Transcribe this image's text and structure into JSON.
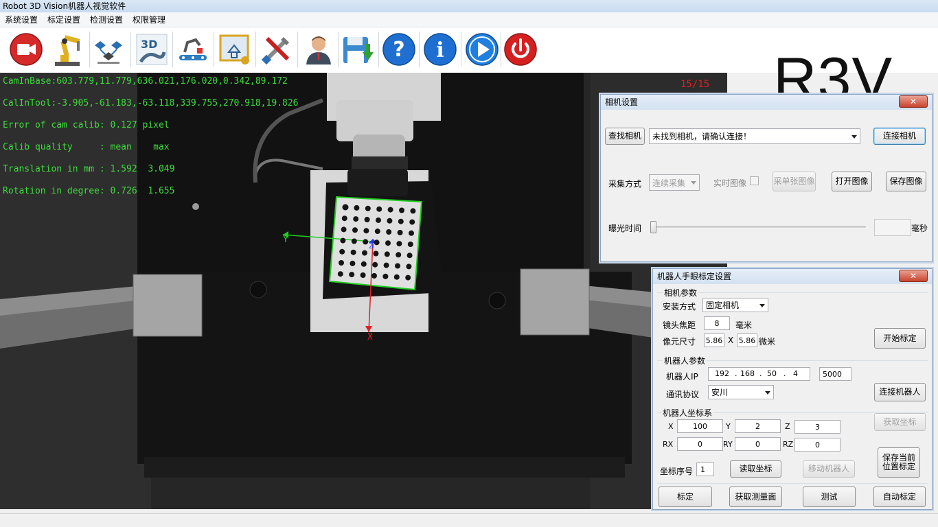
{
  "app": {
    "title": "Robot 3D Vision机器人视觉软件",
    "logo": "R3V"
  },
  "menu": [
    "系统设置",
    "标定设置",
    "检测设置",
    "权限管理"
  ],
  "toolbar": [
    {
      "name": "camera-record-icon",
      "color": "#d62a2a"
    },
    {
      "name": "robot-arm-icon",
      "color": "#e0b020"
    },
    {
      "name": "hand-eye-calibration-icon",
      "color": "#2a6fb6"
    },
    {
      "name": "3d-model-icon",
      "color": "#4a6a8a"
    },
    {
      "name": "conveyor-robot-icon",
      "color": "#555555"
    },
    {
      "name": "measurement-ruler-icon",
      "color": "#d9a520"
    },
    {
      "name": "tools-icon",
      "color": "#c82020"
    },
    {
      "name": "user-icon",
      "color": "#c8874a"
    },
    {
      "name": "save-download-icon",
      "color": "#3a8ad0"
    },
    {
      "name": "help-icon",
      "color": "#1f6fd1"
    },
    {
      "name": "info-icon",
      "color": "#1f6fd1"
    },
    {
      "name": "play-icon",
      "color": "#1f7fe0"
    },
    {
      "name": "power-icon",
      "color": "#d61f1f"
    }
  ],
  "viewer": {
    "counter": "15/15",
    "overlay": [
      "CamInBase:603.779,11.779,636.021,176.020,0.342,89.172",
      "CalInTool:-3.905,-61.183,-63.118,339.755,270.918,19.826",
      "Error of cam calib: 0.127 pixel",
      "Calib quality     : mean    max",
      "Translation in mm : 1.592  3.049",
      "Rotation in degree: 0.726  1.655"
    ],
    "axis_x": "X",
    "axis_y": "Y",
    "axis_z": "Z"
  },
  "camera_dialog": {
    "title": "相机设置",
    "close": "✕",
    "find_camera": "查找相机",
    "camera_select": "未找到相机，请确认连接！",
    "connect_camera": "连接相机",
    "capture_mode_label": "采集方式",
    "capture_mode": "连续采集",
    "live_image": "实时图像",
    "capture_single": "采单张图像",
    "open_image": "打开图像",
    "save_image": "保存图像",
    "exposure_label": "曝光时间",
    "exposure_unit": "毫秒",
    "exposure_value": ""
  },
  "handeye_dialog": {
    "title": "机器人手眼标定设置",
    "close": "✕",
    "camera_params": "相机参数",
    "mount_label": "安装方式",
    "mount_value": "固定相机",
    "focal_label": "镜头焦距",
    "focal_value": "8",
    "focal_unit": "毫米",
    "pixel_label": "像元尺寸",
    "pixel_w": "5.86",
    "pixel_x": "X",
    "pixel_h": "5.86",
    "pixel_unit": "微米",
    "start_calib": "开始标定",
    "robot_params": "机器人参数",
    "robot_ip_label": "机器人IP",
    "ip": [
      "192",
      "168",
      "50",
      "4"
    ],
    "ip_dot": ".",
    "port": "5000",
    "protocol_label": "通讯协议",
    "protocol_value": "安川",
    "connect_robot": "连接机器人",
    "coord_title": "机器人坐标系",
    "x_label": "X",
    "x": "100",
    "y_label": "Y",
    "y": "2",
    "z_label": "Z",
    "z": "3",
    "rx_label": "RX",
    "rx": "0",
    "ry_label": "RY",
    "ry": "0",
    "rz_label": "RZ",
    "rz": "0",
    "get_coord": "获取坐标",
    "index_label": "坐标序号",
    "index_value": "1",
    "read_coord": "读取坐标",
    "move_robot": "移动机器人",
    "save_pos_line1": "保存当前",
    "save_pos_line2": "位置标定",
    "calibrate": "标定",
    "get_plane": "获取测量面",
    "test": "测试",
    "auto_calib": "自动标定"
  }
}
